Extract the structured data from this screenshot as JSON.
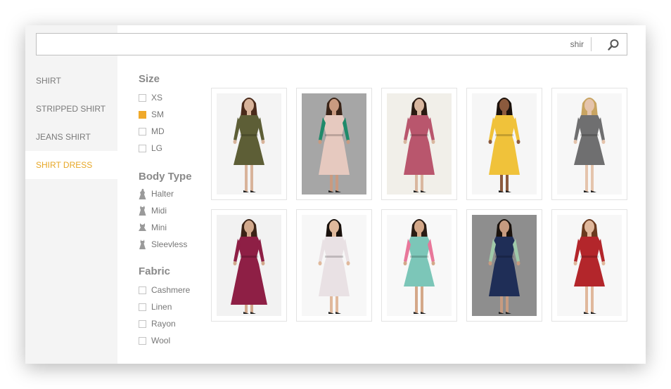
{
  "search": {
    "value": "shir"
  },
  "nav": {
    "items": [
      {
        "label": "SHIRT",
        "active": false
      },
      {
        "label": "STRIPPED SHIRT",
        "active": false
      },
      {
        "label": "JEANS SHIRT",
        "active": false
      },
      {
        "label": "SHIRT DRESS",
        "active": true
      }
    ]
  },
  "filters": {
    "size": {
      "title": "Size",
      "options": [
        {
          "label": "XS",
          "checked": false
        },
        {
          "label": "SM",
          "checked": true
        },
        {
          "label": "MD",
          "checked": false
        },
        {
          "label": "LG",
          "checked": false
        }
      ]
    },
    "body_type": {
      "title": "Body Type",
      "options": [
        {
          "label": "Halter",
          "icon": "halter-dress-icon"
        },
        {
          "label": "Midi",
          "icon": "midi-dress-icon"
        },
        {
          "label": "Mini",
          "icon": "mini-dress-icon"
        },
        {
          "label": "Sleevless",
          "icon": "sleeveless-dress-icon"
        }
      ]
    },
    "fabric": {
      "title": "Fabric",
      "options": [
        {
          "label": "Cashmere",
          "checked": false
        },
        {
          "label": "Linen",
          "checked": false
        },
        {
          "label": "Rayon",
          "checked": false
        },
        {
          "label": "Wool",
          "checked": false
        }
      ]
    }
  },
  "products": [
    {
      "dress": "#5d5e36",
      "bg": "#f4f4f4",
      "skin": "#d8b39a",
      "hair": "#4a2a1a",
      "len": "mini"
    },
    {
      "dress": "#e6c9bf",
      "accent": "#1f8a6a",
      "bg": "#a6a6a6",
      "skin": "#c99a80",
      "hair": "#3a2418",
      "len": "midi"
    },
    {
      "dress": "#b9566d",
      "bg": "#f1efe9",
      "skin": "#d9b79f",
      "hair": "#2a1a12",
      "len": "midi"
    },
    {
      "dress": "#f0c23a",
      "bg": "#f6f6f6",
      "skin": "#8c5a3d",
      "hair": "#1c120c",
      "len": "midi"
    },
    {
      "dress": "#6f6f70",
      "bg": "#f7f7f7",
      "skin": "#e5c4ac",
      "hair": "#c8a461",
      "len": "mini"
    },
    {
      "dress": "#8e1f45",
      "bg": "#f2f2f2",
      "skin": "#d2a98c",
      "hair": "#3b2316",
      "len": "maxi"
    },
    {
      "dress": "#e9e1e4",
      "bg": "#f7f7f7",
      "skin": "#e0b99c",
      "hair": "#1a120d",
      "len": "midi"
    },
    {
      "dress": "#7cc6b8",
      "accent": "#e8779a",
      "bg": "#f8f8f8",
      "skin": "#d4a889",
      "hair": "#2a1c14",
      "len": "mini"
    },
    {
      "dress": "#1f2e57",
      "accent": "#9fc9a9",
      "bg": "#8e8e8e",
      "skin": "#c79b80",
      "hair": "#1a120d",
      "len": "midi"
    },
    {
      "dress": "#b3262b",
      "bg": "#f7f7f7",
      "skin": "#e0b89c",
      "hair": "#6a3a1f",
      "len": "mini"
    }
  ],
  "colors": {
    "accent": "#e7a726",
    "sidebar_bg": "#f4f4f4"
  }
}
